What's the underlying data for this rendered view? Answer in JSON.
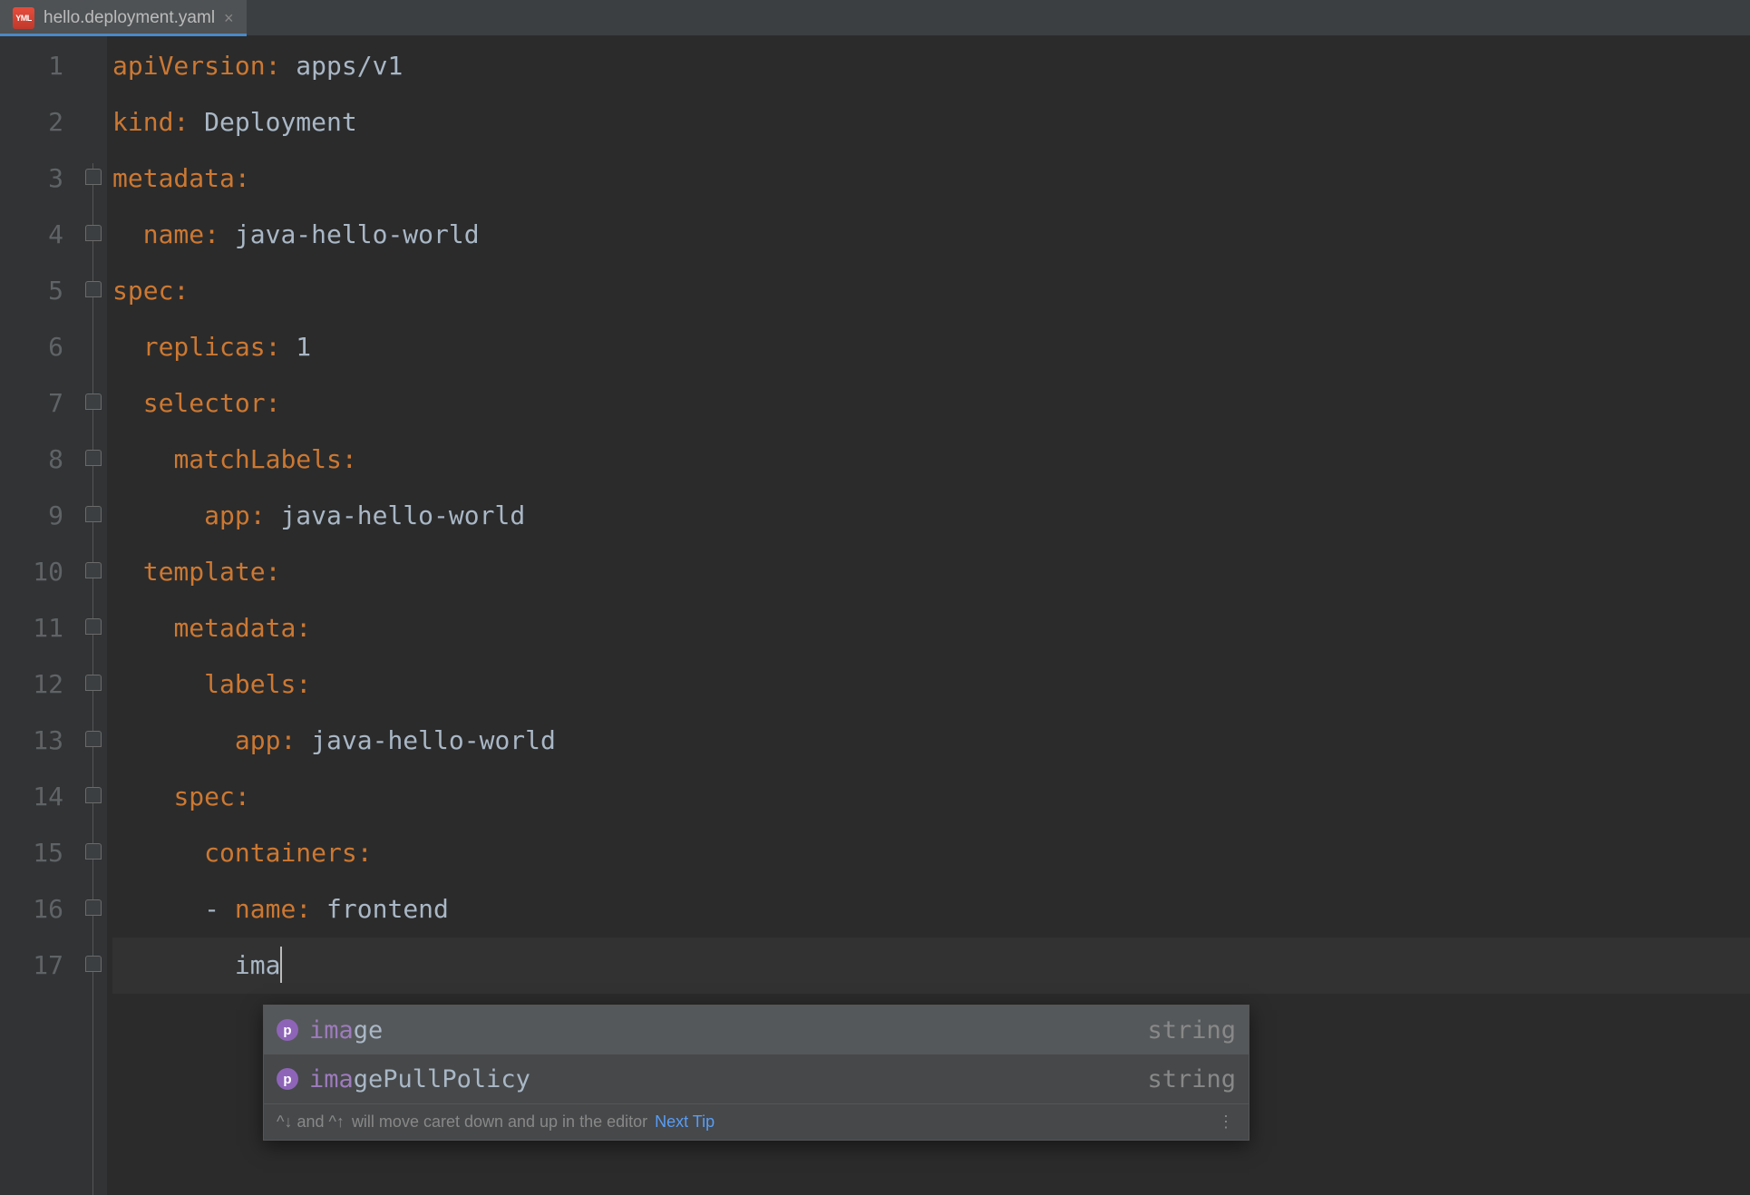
{
  "tab": {
    "icon_text": "YML",
    "filename": "hello.deployment.yaml",
    "close_glyph": "×"
  },
  "gutter": {
    "numbers": [
      "1",
      "2",
      "3",
      "4",
      "5",
      "6",
      "7",
      "8",
      "9",
      "10",
      "11",
      "12",
      "13",
      "14",
      "15",
      "16",
      "17"
    ]
  },
  "code": {
    "l1_key": "apiVersion",
    "l1_val": "apps/v1",
    "l2_key": "kind",
    "l2_val": "Deployment",
    "l3_key": "metadata",
    "l4_key": "name",
    "l4_val": "java-hello-world",
    "l5_key": "spec",
    "l6_key": "replicas",
    "l6_val": "1",
    "l7_key": "selector",
    "l8_key": "matchLabels",
    "l9_key": "app",
    "l9_val": "java-hello-world",
    "l10_key": "template",
    "l11_key": "metadata",
    "l12_key": "labels",
    "l13_key": "app",
    "l13_val": "java-hello-world",
    "l14_key": "spec",
    "l15_key": "containers",
    "l16_dash": "-",
    "l16_key": "name",
    "l16_val": "frontend",
    "l17_partial": "ima"
  },
  "popup": {
    "pill_letter": "p",
    "items": [
      {
        "match": "ima",
        "rest": "ge",
        "type": "string"
      },
      {
        "match": "ima",
        "rest": "gePullPolicy",
        "type": "string"
      }
    ],
    "footer_keys": "^↓ and ^↑",
    "footer_text": " will move caret down and up in the editor",
    "footer_link": "Next Tip",
    "footer_dots": "⋮"
  }
}
